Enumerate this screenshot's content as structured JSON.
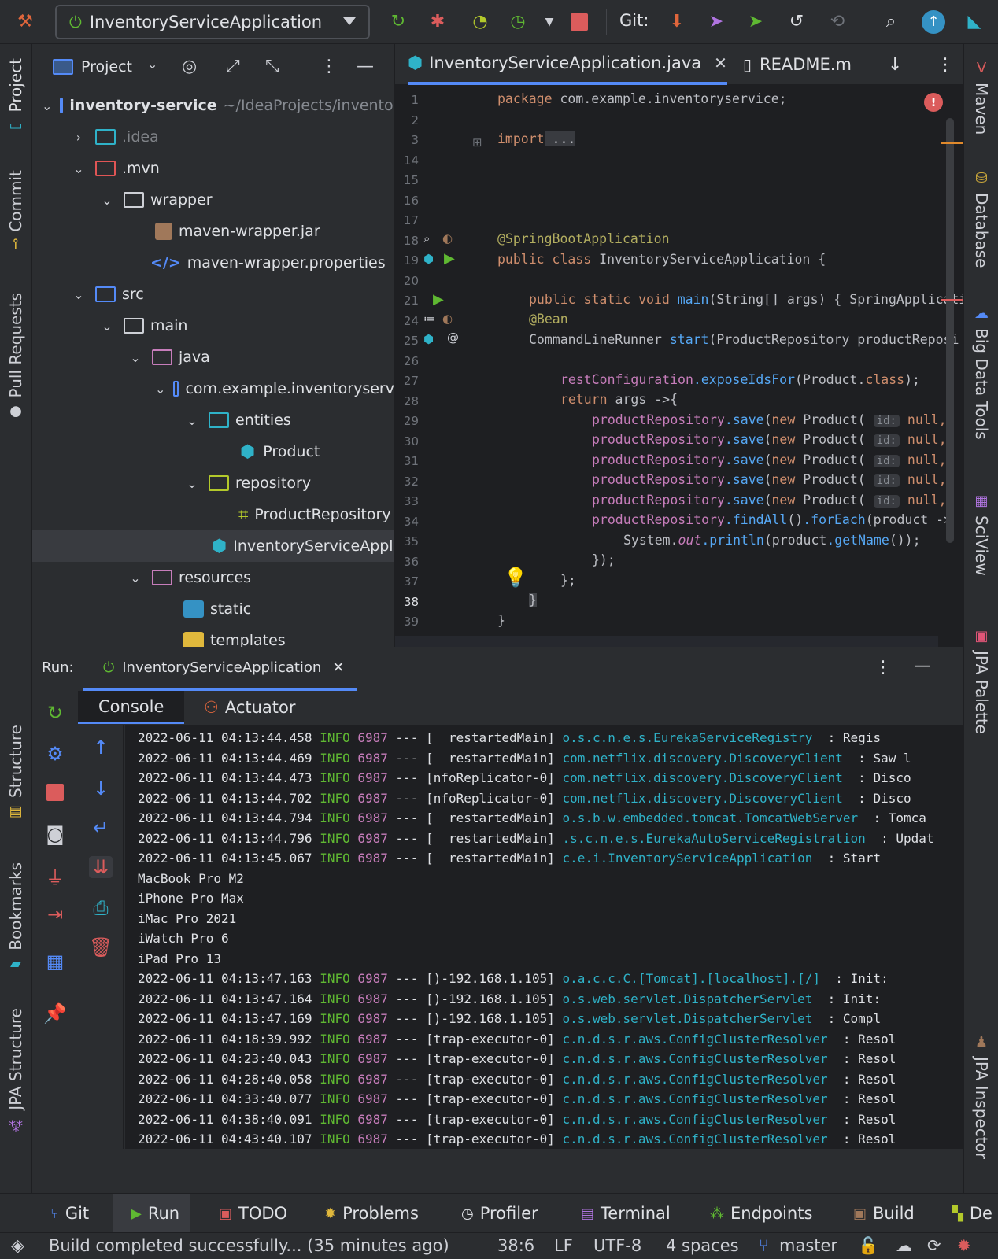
{
  "toolbar": {
    "run_config": "InventoryServiceApplication",
    "git_label": "Git:"
  },
  "left_stripe": {
    "tabs": [
      "Project",
      "Commit",
      "Pull Requests",
      "Structure",
      "Bookmarks",
      "JPA Structure"
    ]
  },
  "right_stripe": {
    "tabs": [
      "Maven",
      "Database",
      "Big Data Tools",
      "SciView",
      "JPA Palette",
      "JPA Inspector"
    ]
  },
  "project": {
    "header": "Project",
    "tree": [
      {
        "label": "inventory-service",
        "hint": "~/IdeaProjects/inventory"
      },
      {
        "label": ".idea"
      },
      {
        "label": ".mvn"
      },
      {
        "label": "wrapper"
      },
      {
        "label": "maven-wrapper.jar"
      },
      {
        "label": "maven-wrapper.properties"
      },
      {
        "label": "src"
      },
      {
        "label": "main"
      },
      {
        "label": "java"
      },
      {
        "label": "com.example.inventoryserv"
      },
      {
        "label": "entities"
      },
      {
        "label": "Product"
      },
      {
        "label": "repository"
      },
      {
        "label": "ProductRepository"
      },
      {
        "label": "InventoryServiceApplic"
      },
      {
        "label": "resources"
      },
      {
        "label": "static"
      },
      {
        "label": "templates"
      }
    ]
  },
  "editor": {
    "tabs": [
      {
        "label": "InventoryServiceApplication.java"
      },
      {
        "label": "README.m"
      }
    ],
    "line_numbers": [
      "1",
      "2",
      "3",
      "14",
      "15",
      "16",
      "17",
      "18",
      "19",
      "20",
      "21",
      "24",
      "25",
      "26",
      "27",
      "28",
      "29",
      "30",
      "31",
      "32",
      "33",
      "34",
      "35",
      "36",
      "37",
      "38",
      "39"
    ],
    "code": {
      "l1_kw": "package",
      "l1_rest": " com.example.inventoryservice;",
      "l3_kw": "import",
      "l3_rest": " ...",
      "l18": "@SpringBootApplication",
      "l19_kw": "public class",
      "l19_rest": " InventoryServiceApplication {",
      "l21_kw": "public static void",
      "l21_fn": " main",
      "l21_rest": "(String[] args) { SpringApplicati",
      "l24": "@Bean",
      "l25_type": "CommandLineRunner",
      "l25_fn": " start",
      "l25_rest": "(ProductRepository productReposi",
      "l27_a": "restConfiguration",
      "l27_fn": ".exposeIdsFor",
      "l27_b": "(Product.",
      "l27_kw": "class",
      "l27_c": ");",
      "l28_kw": "return",
      "l28_rest": " args ->{",
      "save_a": "productRepository",
      "save_fn": ".save",
      "save_b": "(",
      "save_kw": "new",
      "save_c": " Product(",
      "save_hint": "id:",
      "save_null": " null,",
      "l34_a": "productRepository",
      "l34_fn": ".findAll",
      "l34_b": "()",
      "l34_fn2": ".forEach",
      "l34_c": "(product ->",
      "l35_a": "System.",
      "l35_pr": "out",
      "l35_fn": ".println",
      "l35_b": "(product",
      "l35_fn2": ".getName",
      "l35_c": "());",
      "l36": "});",
      "l37": "};",
      "l38": "}",
      "l39": "}"
    }
  },
  "run": {
    "label": "Run:",
    "config_tab": "InventoryServiceApplication",
    "tabs": [
      "Console",
      "Actuator"
    ],
    "log_lines": [
      {
        "ts": "2022-06-11 04:13:44.458",
        "lvl": "INFO",
        "pid": "6987",
        "sep": " --- ",
        "thread": "[  restartedMain]",
        "logger": "o.s.c.n.e.s.EurekaServiceRegistry",
        "msg": ": Regis"
      },
      {
        "ts": "2022-06-11 04:13:44.469",
        "lvl": "INFO",
        "pid": "6987",
        "sep": " --- ",
        "thread": "[  restartedMain]",
        "logger": "com.netflix.discovery.DiscoveryClient",
        "msg": ": Saw l"
      },
      {
        "ts": "2022-06-11 04:13:44.473",
        "lvl": "INFO",
        "pid": "6987",
        "sep": " --- ",
        "thread": "[nfoReplicator-0]",
        "logger": "com.netflix.discovery.DiscoveryClient",
        "msg": ": Disco"
      },
      {
        "ts": "2022-06-11 04:13:44.702",
        "lvl": "INFO",
        "pid": "6987",
        "sep": " --- ",
        "thread": "[nfoReplicator-0]",
        "logger": "com.netflix.discovery.DiscoveryClient",
        "msg": ": Disco"
      },
      {
        "ts": "2022-06-11 04:13:44.794",
        "lvl": "INFO",
        "pid": "6987",
        "sep": " --- ",
        "thread": "[  restartedMain]",
        "logger": "o.s.b.w.embedded.tomcat.TomcatWebServer",
        "msg": ": Tomca"
      },
      {
        "ts": "2022-06-11 04:13:44.796",
        "lvl": "INFO",
        "pid": "6987",
        "sep": " --- ",
        "thread": "[  restartedMain]",
        "logger": ".s.c.n.e.s.EurekaAutoServiceRegistration",
        "msg": ": Updat"
      },
      {
        "ts": "2022-06-11 04:13:45.067",
        "lvl": "INFO",
        "pid": "6987",
        "sep": " --- ",
        "thread": "[  restartedMain]",
        "logger": "c.e.i.InventoryServiceApplication",
        "msg": ": Start"
      }
    ],
    "plain_lines": [
      "MacBook Pro M2",
      "iPhone Pro Max",
      "iMac Pro 2021",
      "iWatch Pro 6",
      "iPad Pro 13"
    ],
    "log_lines2": [
      {
        "ts": "2022-06-11 04:13:47.163",
        "lvl": "INFO",
        "pid": "6987",
        "sep": " --- ",
        "thread": "[)-192.168.1.105]",
        "logger": "o.a.c.c.C.[Tomcat].[localhost].[/]",
        "msg": ": Init:"
      },
      {
        "ts": "2022-06-11 04:13:47.164",
        "lvl": "INFO",
        "pid": "6987",
        "sep": " --- ",
        "thread": "[)-192.168.1.105]",
        "logger": "o.s.web.servlet.DispatcherServlet",
        "msg": ": Init:"
      },
      {
        "ts": "2022-06-11 04:13:47.169",
        "lvl": "INFO",
        "pid": "6987",
        "sep": " --- ",
        "thread": "[)-192.168.1.105]",
        "logger": "o.s.web.servlet.DispatcherServlet",
        "msg": ": Compl"
      },
      {
        "ts": "2022-06-11 04:18:39.992",
        "lvl": "INFO",
        "pid": "6987",
        "sep": " --- ",
        "thread": "[trap-executor-0]",
        "logger": "c.n.d.s.r.aws.ConfigClusterResolver",
        "msg": ": Resol"
      },
      {
        "ts": "2022-06-11 04:23:40.043",
        "lvl": "INFO",
        "pid": "6987",
        "sep": " --- ",
        "thread": "[trap-executor-0]",
        "logger": "c.n.d.s.r.aws.ConfigClusterResolver",
        "msg": ": Resol"
      },
      {
        "ts": "2022-06-11 04:28:40.058",
        "lvl": "INFO",
        "pid": "6987",
        "sep": " --- ",
        "thread": "[trap-executor-0]",
        "logger": "c.n.d.s.r.aws.ConfigClusterResolver",
        "msg": ": Resol"
      },
      {
        "ts": "2022-06-11 04:33:40.077",
        "lvl": "INFO",
        "pid": "6987",
        "sep": " --- ",
        "thread": "[trap-executor-0]",
        "logger": "c.n.d.s.r.aws.ConfigClusterResolver",
        "msg": ": Resol"
      },
      {
        "ts": "2022-06-11 04:38:40.091",
        "lvl": "INFO",
        "pid": "6987",
        "sep": " --- ",
        "thread": "[trap-executor-0]",
        "logger": "c.n.d.s.r.aws.ConfigClusterResolver",
        "msg": ": Resol"
      },
      {
        "ts": "2022-06-11 04:43:40.107",
        "lvl": "INFO",
        "pid": "6987",
        "sep": " --- ",
        "thread": "[trap-executor-0]",
        "logger": "c.n.d.s.r.aws.ConfigClusterResolver",
        "msg": ": Resol"
      }
    ]
  },
  "bottom_tools": [
    "Git",
    "Run",
    "TODO",
    "Problems",
    "Profiler",
    "Terminal",
    "Endpoints",
    "Build",
    "De"
  ],
  "status": {
    "message": "Build completed successfully... (35 minutes ago)",
    "position": "38:6",
    "line_sep": "LF",
    "encoding": "UTF-8",
    "indent": "4 spaces",
    "branch": "master"
  },
  "colors": {
    "bg": "#1e1f22",
    "panel": "#2b2d30",
    "accent": "#548af7",
    "keyword": "#cf8e6d",
    "annotation": "#b3ae60",
    "method": "#56a8f5",
    "info_green": "#5fb832",
    "logger_cyan": "#2fb2c8",
    "pid_purple": "#c77dbb",
    "stop_red": "#db5c5c"
  }
}
